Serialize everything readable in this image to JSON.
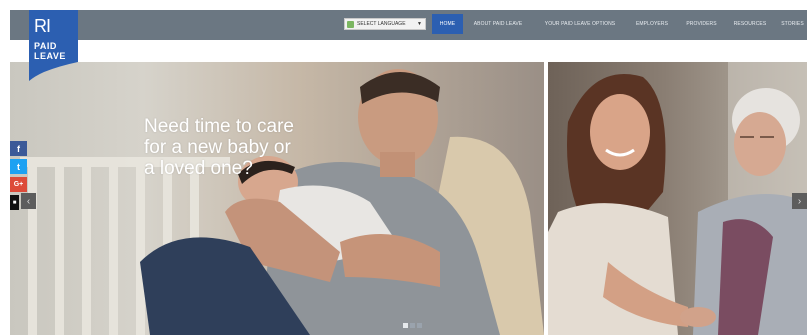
{
  "header": {
    "logo": {
      "line1": "RI",
      "line2": "PAID",
      "line3": "LEAVE"
    },
    "language": {
      "label": "SELECT LANGUAGE",
      "caret": "▼"
    },
    "nav": [
      {
        "label": "HOME",
        "active": true
      },
      {
        "label": "ABOUT PAID LEAVE",
        "active": false
      },
      {
        "label": "YOUR PAID LEAVE OPTIONS",
        "active": false
      },
      {
        "label": "EMPLOYERS",
        "active": false
      },
      {
        "label": "PROVIDERS",
        "active": false
      },
      {
        "label": "RESOURCES",
        "active": false
      },
      {
        "label": "STORIES",
        "active": false
      }
    ]
  },
  "hero": {
    "headline": [
      "Need time to care",
      "for a new baby or",
      "a loved one?"
    ],
    "prev_arrow": "‹",
    "next_arrow": "›"
  },
  "social": [
    {
      "icon": "facebook-icon",
      "glyph": "f",
      "color": "#3b5998"
    },
    {
      "icon": "twitter-icon",
      "glyph": "t",
      "color": "#1da1f2"
    },
    {
      "icon": "googleplus-icon",
      "glyph": "G+",
      "color": "#dd4b39"
    },
    {
      "icon": "email-icon",
      "glyph": "■",
      "color": "#111111"
    }
  ],
  "slider": {
    "slides": 3,
    "active": 0
  },
  "colors": {
    "nav_bg": "#6b7782",
    "active_nav": "#2c5fb1",
    "logo": "#2c5fb1"
  }
}
